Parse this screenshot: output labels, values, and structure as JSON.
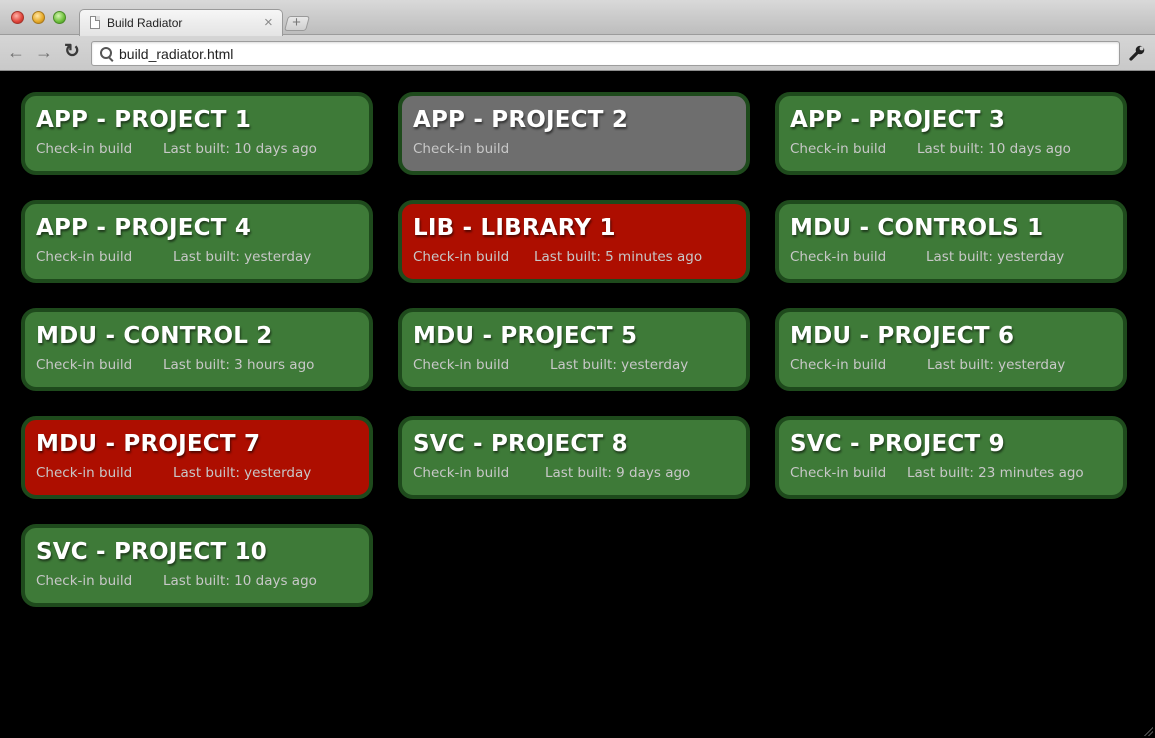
{
  "browser": {
    "tab_title": "Build Radiator",
    "tab_close": "×",
    "new_tab": "+",
    "url": "build_radiator.html",
    "back": "←",
    "forward": "→",
    "reload": "↻"
  },
  "status_colors": {
    "ok": "#3e7a38",
    "failed": "#ad0e00",
    "off": "#6e6e6e",
    "border": "#1e4a1c"
  },
  "builds": [
    {
      "name": "APP - PROJECT 1",
      "type": "Check-in build",
      "last_built": "Last built: 10 days ago",
      "status": "ok"
    },
    {
      "name": "APP - PROJECT 2",
      "type": "Check-in build",
      "last_built": "",
      "status": "off"
    },
    {
      "name": "APP - PROJECT 3",
      "type": "Check-in build",
      "last_built": "Last built: 10 days ago",
      "status": "ok"
    },
    {
      "name": "APP - PROJECT 4",
      "type": "Check-in build",
      "last_built": "Last built: yesterday",
      "status": "ok"
    },
    {
      "name": "LIB - LIBRARY 1",
      "type": "Check-in build",
      "last_built": "Last built: 5 minutes ago",
      "status": "failed"
    },
    {
      "name": "MDU - CONTROLS 1",
      "type": "Check-in build",
      "last_built": "Last built: yesterday",
      "status": "ok"
    },
    {
      "name": "MDU - CONTROL 2",
      "type": "Check-in build",
      "last_built": "Last built: 3 hours ago",
      "status": "ok"
    },
    {
      "name": "MDU - PROJECT 5",
      "type": "Check-in build",
      "last_built": "Last built: yesterday",
      "status": "ok"
    },
    {
      "name": "MDU - PROJECT 6",
      "type": "Check-in build",
      "last_built": "Last built: yesterday",
      "status": "ok"
    },
    {
      "name": "MDU - PROJECT 7",
      "type": "Check-in build",
      "last_built": "Last built: yesterday",
      "status": "failed"
    },
    {
      "name": "SVC - PROJECT 8",
      "type": "Check-in build",
      "last_built": "Last built: 9 days ago",
      "status": "ok"
    },
    {
      "name": "SVC - PROJECT 9",
      "type": "Check-in build",
      "last_built": "Last built: 23 minutes ago",
      "status": "ok"
    },
    {
      "name": "SVC - PROJECT 10",
      "type": "Check-in build",
      "last_built": "Last built: 10 days ago",
      "status": "ok"
    }
  ]
}
